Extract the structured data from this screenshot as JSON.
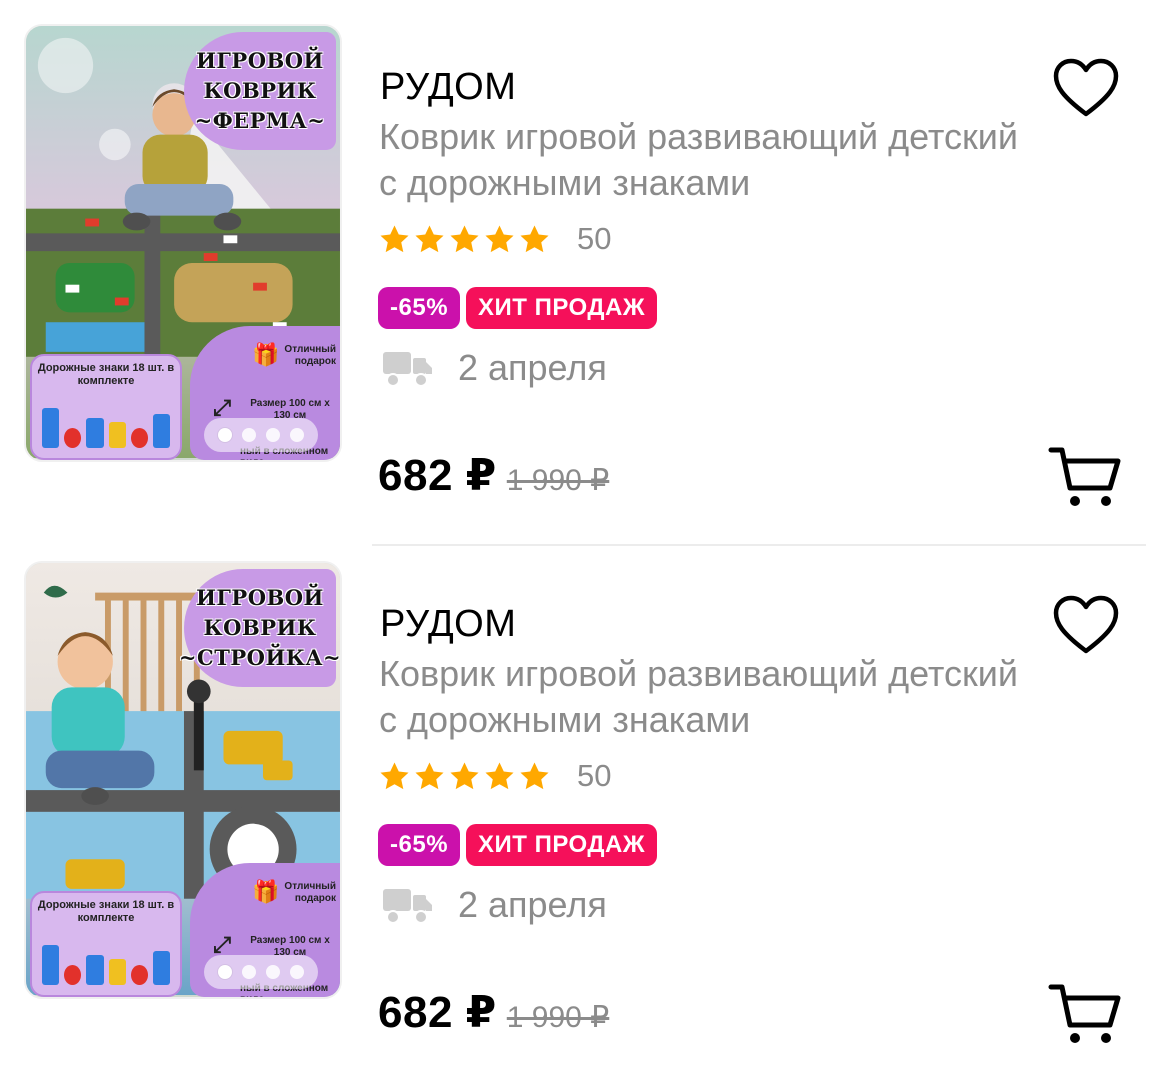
{
  "products": [
    {
      "brand": "РУДОМ",
      "title": "Коврик игровой развивающий детский с дорожными знаками",
      "rating_count": "50",
      "rating": 5,
      "badges": {
        "discount": "-65%",
        "hit": "ХИТ ПРОДАЖ"
      },
      "delivery": "2 апреля",
      "price": "682 ₽",
      "old_price": "1 990 ₽",
      "image": {
        "banner": [
          "ИГРОВОЙ",
          "КОВРИК",
          "~ФЕРМА~"
        ],
        "signs_text": "Дорожные знаки 18 шт. в комплекте",
        "gift_text": "Отличный подарок",
        "size_text": "Размер 100 см х 130 см",
        "folded_text": "ный в сложенном виде",
        "active_slide": 1,
        "slide_count": 4
      }
    },
    {
      "brand": "РУДОМ",
      "title": "Коврик игровой развивающий детский с дорожными знаками",
      "rating_count": "50",
      "rating": 5,
      "badges": {
        "discount": "-65%",
        "hit": "ХИТ ПРОДАЖ"
      },
      "delivery": "2 апреля",
      "price": "682 ₽",
      "old_price": "1 990 ₽",
      "image": {
        "banner": [
          "ИГРОВОЙ",
          "КОВРИК",
          "~СТРОЙКА~"
        ],
        "signs_text": "Дорожные знаки 18 шт. в комплекте",
        "gift_text": "Отличный подарок",
        "size_text": "Размер 100 см х 130 см",
        "folded_text": "ный в сложенном виде",
        "active_slide": 1,
        "slide_count": 4
      }
    }
  ],
  "icons": {
    "favorite": "heart-outline-icon",
    "cart": "shopping-cart-icon",
    "delivery": "truck-icon",
    "star": "star-icon",
    "gift": "gift-icon",
    "expand": "expand-icon"
  },
  "colors": {
    "star": "#ffa800",
    "discount_badge": "#cb11ab",
    "hit_badge": "#f5105a",
    "secondary_text": "#8b8b8b",
    "truck": "#cfcfcf"
  }
}
